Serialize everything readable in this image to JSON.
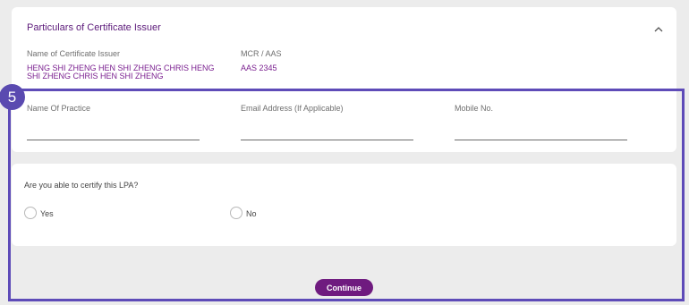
{
  "issuer_section": {
    "title": "Particulars of Certificate Issuer",
    "name_label": "Name of Certificate Issuer",
    "name_value_line1": "HENG SHI ZHENG HEN SHI ZHENG CHRIS HENG",
    "name_value_line2": "SHI ZHENG CHRIS HEN SHI ZHENG",
    "mcr_label": "MCR / AAS",
    "mcr_value": "AAS 2345",
    "practice_label": "Name Of Practice",
    "email_label": "Email Address (If Applicable)",
    "mobile_label": "Mobile No."
  },
  "certify_section": {
    "question": "Are you able to certify this LPA?",
    "yes_label": "Yes",
    "no_label": "No"
  },
  "step_badge": "5",
  "continue_label": "Continue",
  "colors": {
    "accent": "#6f1b7f",
    "highlight": "#5e4bb8",
    "value_text": "#7a1f8f"
  }
}
